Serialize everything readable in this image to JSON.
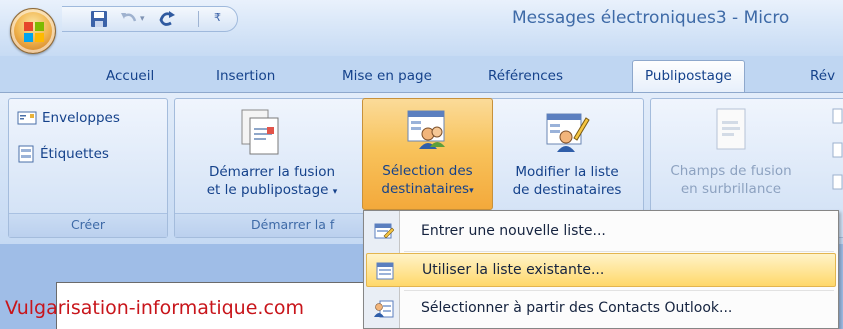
{
  "window": {
    "title": "Messages électroniques3 - Micro"
  },
  "tabs": [
    {
      "label": "Accueil"
    },
    {
      "label": "Insertion"
    },
    {
      "label": "Mise en page"
    },
    {
      "label": "Références"
    },
    {
      "label": "Publipostage",
      "active": true
    },
    {
      "label": "Rév"
    }
  ],
  "ribbon": {
    "group_creer": {
      "label": "Créer",
      "envelopes": "Enveloppes",
      "labels": "Étiquettes"
    },
    "group_demarrer": {
      "label": "Démarrer la f",
      "start_merge": {
        "line1": "Démarrer la fusion",
        "line2": "et le publipostage"
      },
      "select_recipients": {
        "line1": "Sélection des",
        "line2": "destinataires"
      },
      "edit_list": {
        "line1": "Modifier la liste",
        "line2": "de destinataires"
      }
    },
    "group_fields": {
      "highlight": {
        "line1": "Champs de fusion",
        "line2": "en surbrillance"
      }
    }
  },
  "menu": {
    "items": [
      {
        "label": "Entrer une nouvelle liste...",
        "icon": "new-list-icon"
      },
      {
        "label": "Utiliser la liste existante...",
        "icon": "existing-list-icon",
        "highlighted": true
      },
      {
        "label": "Sélectionner à partir des Contacts Outlook...",
        "icon": "outlook-contacts-icon"
      }
    ]
  },
  "watermark": "Vulgarisation-informatique.com",
  "colors": {
    "ribbon_text": "#15428b",
    "pressed": "#f8c35c",
    "menu_hover": "#ffd86a",
    "watermark": "#c8151b"
  }
}
